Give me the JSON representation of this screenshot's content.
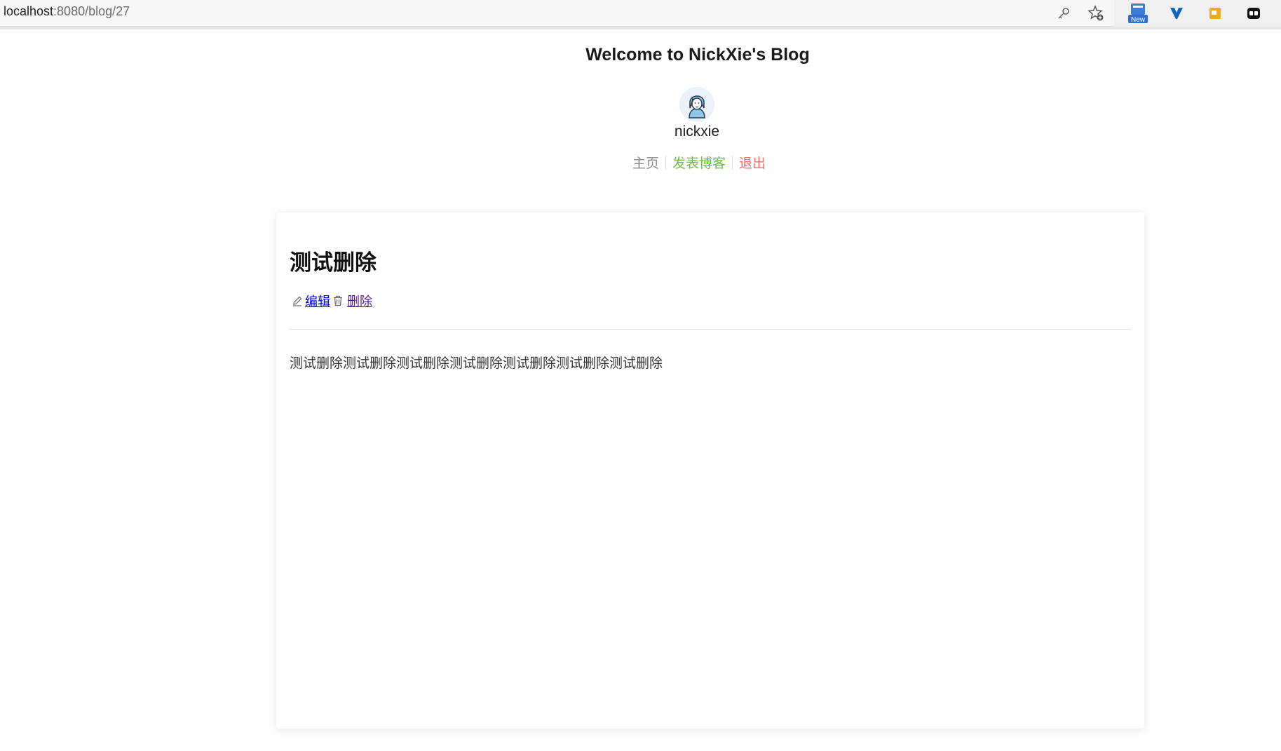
{
  "browser": {
    "url_host": "localhost",
    "url_path": ":8080/blog/27",
    "icons": [
      "key-icon",
      "star-add-icon",
      "new-extension-icon",
      "extension-v-icon",
      "extension-orange-icon",
      "extension-black-icon"
    ],
    "new_badge": "New"
  },
  "header": {
    "site_title": "Welcome to NickXie's Blog",
    "username": "nickxie",
    "nav": {
      "home": "主页",
      "post": "发表博客",
      "logout": "退出"
    }
  },
  "blog": {
    "title": "测试删除",
    "edit_label": "编辑",
    "delete_label": "删除",
    "content": "测试删除测试删除测试删除测试删除测试删除测试删除测试删除"
  },
  "colors": {
    "home": "#8a8a8a",
    "post": "#67c23a",
    "logout": "#f56c6c",
    "link": "#0000ee",
    "link_visited": "#551a8b"
  }
}
